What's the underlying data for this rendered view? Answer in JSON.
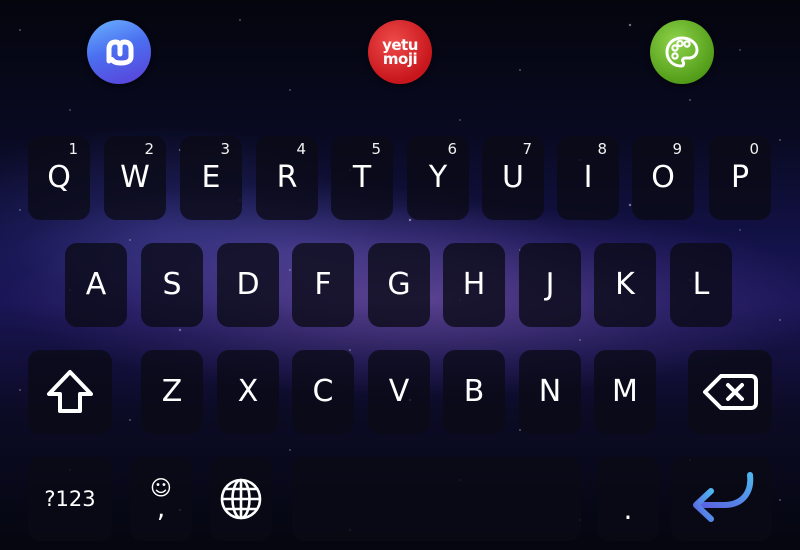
{
  "top_bar": {
    "apps": [
      {
        "name": "mastodon",
        "icon": "mastodon-icon"
      },
      {
        "name": "yetumoji",
        "icon": "yetumoji-icon",
        "label": "yetu\nmoji",
        "line1": "yetu",
        "line2": "moji"
      },
      {
        "name": "palette",
        "icon": "palette-icon"
      }
    ],
    "colors": {
      "mastodon": "#5a6ff0",
      "yetumoji": "#d41e24",
      "palette": "#6cb62b"
    }
  },
  "keyboard": {
    "row1": [
      {
        "label": "Q",
        "hint": "1"
      },
      {
        "label": "W",
        "hint": "2"
      },
      {
        "label": "E",
        "hint": "3"
      },
      {
        "label": "R",
        "hint": "4"
      },
      {
        "label": "T",
        "hint": "5"
      },
      {
        "label": "Y",
        "hint": "6"
      },
      {
        "label": "U",
        "hint": "7"
      },
      {
        "label": "I",
        "hint": "8"
      },
      {
        "label": "O",
        "hint": "9"
      },
      {
        "label": "P",
        "hint": "0"
      }
    ],
    "row2": [
      "A",
      "S",
      "D",
      "F",
      "G",
      "H",
      "J",
      "K",
      "L"
    ],
    "row3": [
      "Z",
      "X",
      "C",
      "V",
      "B",
      "N",
      "M"
    ],
    "bottom": {
      "symbols_label": "?123",
      "emoji_symbol": "☺",
      "comma": ",",
      "period": ".",
      "icons": {
        "shift": "shift-icon",
        "backspace": "backspace-icon",
        "globe": "globe-icon",
        "enter": "enter-icon"
      }
    },
    "accent_color": "#4a6cf7"
  }
}
